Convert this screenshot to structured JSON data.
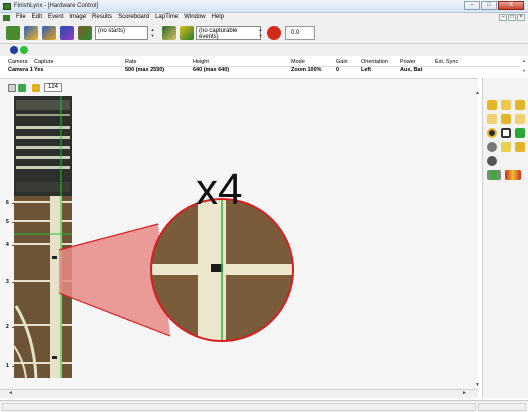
{
  "window": {
    "title": "FinishLynx - [Hardware Control]",
    "minimize": "–",
    "maximize": "□",
    "close": "X"
  },
  "menu": {
    "items": [
      "File",
      "Edit",
      "Event",
      "Image",
      "Results",
      "Scoreboard",
      "LapTime",
      "Window",
      "Help"
    ],
    "mdi_min": "–",
    "mdi_max": "□",
    "mdi_close": "×"
  },
  "toolbar": {
    "starts_select": "(no starts)",
    "events_select": "(no capturable events)",
    "zoom_value": "0.0"
  },
  "camera_table": {
    "headers": [
      "Camera",
      "Capture",
      "Rate",
      "Height",
      "Mode",
      "Gain",
      "Orientation",
      "Power",
      "Ext. Sync"
    ],
    "values": [
      "Camera 1",
      "Yes",
      "500  (max 2550)",
      "640  (max 640)",
      "Zoom 100%",
      "0",
      "Left",
      "Aux, Bat",
      ""
    ]
  },
  "image_tools": {
    "frame_count": "124"
  },
  "ruler": {
    "labels": [
      "6",
      "5",
      "4",
      "3",
      "2",
      "1"
    ]
  },
  "annotation": {
    "magnification": "x4"
  },
  "colors": {
    "finish_line": "#19c23a",
    "callout_red": "#d62020",
    "track_brown": "#6e5436"
  },
  "icons": {
    "app": "finishlynx-icon",
    "palette": [
      "pointer-icon",
      "flag-icon",
      "pencil-icon",
      "hide-icon",
      "info-icon",
      "eye-icon",
      "circle-icon",
      "zoom-box-icon",
      "plus-icon",
      "target-icon",
      "grid-add-icon",
      "minus-icon",
      "record-icon",
      "color-bars-icon",
      "flag-pair-icon"
    ]
  }
}
